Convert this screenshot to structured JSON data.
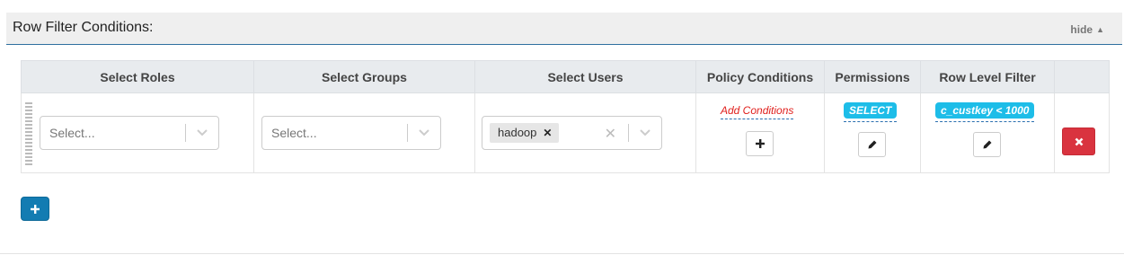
{
  "panel": {
    "title": "Row Filter Conditions:",
    "toggle_label": "hide"
  },
  "table": {
    "headers": [
      "Select Roles",
      "Select Groups",
      "Select Users",
      "Policy Conditions",
      "Permissions",
      "Row Level Filter",
      ""
    ],
    "rows": [
      {
        "roles_placeholder": "Select...",
        "groups_placeholder": "Select...",
        "users_selected": [
          "hadoop"
        ],
        "policy_conditions_link": "Add Conditions",
        "permissions": [
          "SELECT"
        ],
        "row_level_filter": "c_custkey < 1000"
      }
    ]
  },
  "icons": {
    "toggle": "caret-up-icon",
    "add_condition": "plus-icon",
    "edit_permissions": "pencil-icon",
    "edit_filter": "pencil-icon",
    "delete_row": "close-icon",
    "add_row": "plus-icon"
  },
  "colors": {
    "pill": "#1dbde8",
    "link": "#e0201d",
    "danger": "#d9333f",
    "primary": "#137cb2"
  }
}
